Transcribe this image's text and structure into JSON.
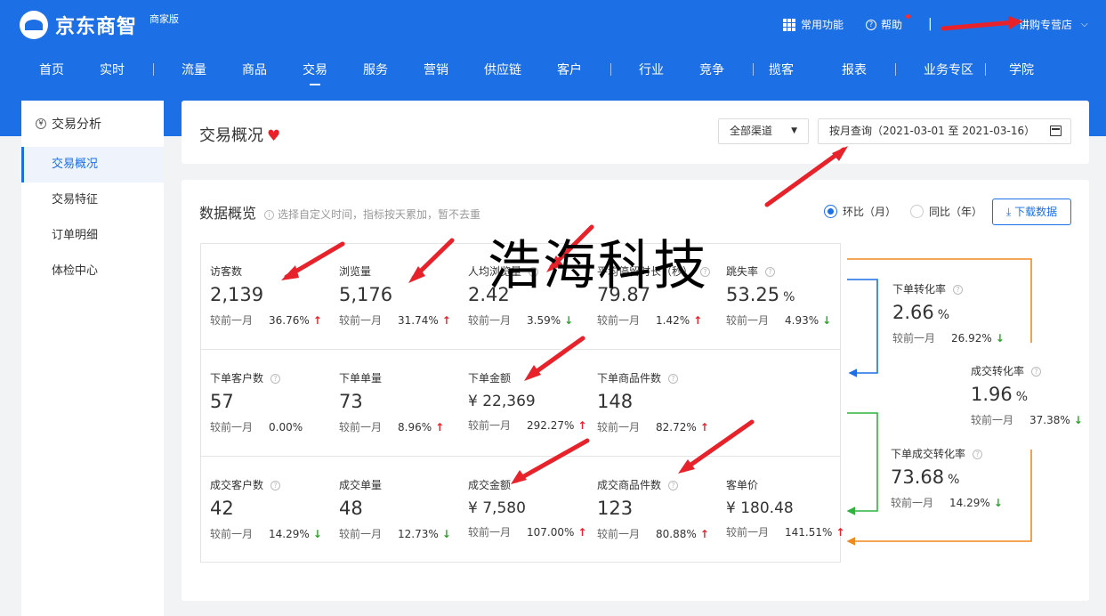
{
  "header": {
    "brand": "京东商智",
    "edition": "商家版",
    "tools": {
      "common": "常用功能",
      "help": "帮助",
      "shop": "讲购专营店"
    },
    "nav": [
      "首页",
      "实时",
      "流量",
      "商品",
      "交易",
      "服务",
      "营销",
      "供应链",
      "客户",
      "行业",
      "竞争",
      "揽客",
      "报表",
      "业务专区",
      "学院"
    ],
    "active_nav": "交易"
  },
  "sidebar": {
    "title": "交易分析",
    "items": [
      "交易概况",
      "交易特征",
      "订单明细",
      "体检中心"
    ],
    "active": "交易概况"
  },
  "overview": {
    "title": "交易概况",
    "channel": "全部渠道",
    "date_range": "按月查询（2021-03-01 至 2021-03-16）"
  },
  "data_panel": {
    "title": "数据概览",
    "hint": "选择自定义时间，指标按天累加，暂不去重",
    "radio_mom": "环比（月）",
    "radio_yoy": "同比（年）",
    "download": "下载数据",
    "compare_label": "较前一月"
  },
  "metrics": {
    "visitors": {
      "label": "访客数",
      "value": "2,139",
      "pct": "36.76%",
      "trend": "up"
    },
    "pageviews": {
      "label": "浏览量",
      "value": "5,176",
      "pct": "31.74%",
      "trend": "up"
    },
    "avg_pv": {
      "label": "人均浏览量",
      "value": "2.42",
      "pct": "3.59%",
      "trend": "down"
    },
    "avg_stay": {
      "label": "平均停留时长（秒）",
      "value": "79.87",
      "pct": "1.42%",
      "trend": "up"
    },
    "bounce": {
      "label": "跳失率",
      "value": "53.25",
      "unit": "%",
      "pct": "4.93%",
      "trend": "down"
    },
    "order_customers": {
      "label": "下单客户数",
      "value": "57",
      "pct": "0.00%",
      "trend": ""
    },
    "order_count": {
      "label": "下单单量",
      "value": "73",
      "pct": "8.96%",
      "trend": "up"
    },
    "order_amount": {
      "label": "下单金额",
      "value": "¥ 22,369",
      "pct": "292.27%",
      "trend": "up"
    },
    "order_items": {
      "label": "下单商品件数",
      "value": "148",
      "pct": "82.72%",
      "trend": "up"
    },
    "deal_customers": {
      "label": "成交客户数",
      "value": "42",
      "pct": "14.29%",
      "trend": "down"
    },
    "deal_count": {
      "label": "成交单量",
      "value": "48",
      "pct": "12.73%",
      "trend": "down"
    },
    "deal_amount": {
      "label": "成交金额",
      "value": "¥ 7,580",
      "pct": "107.00%",
      "trend": "up"
    },
    "deal_items": {
      "label": "成交商品件数",
      "value": "123",
      "pct": "80.88%",
      "trend": "up"
    },
    "avg_price": {
      "label": "客单价",
      "value": "¥ 180.48",
      "pct": "141.51%",
      "trend": "up"
    },
    "order_conv": {
      "label": "下单转化率",
      "value": "2.66",
      "unit": "%",
      "pct": "26.92%",
      "trend": "down"
    },
    "deal_conv": {
      "label": "成交转化率",
      "value": "1.96",
      "unit": "%",
      "pct": "37.38%",
      "trend": "down"
    },
    "order_deal_conv": {
      "label": "下单成交转化率",
      "value": "73.68",
      "unit": "%",
      "pct": "14.29%",
      "trend": "down"
    }
  },
  "watermark": "浩海科技",
  "colors": {
    "primary": "#1d6fe6",
    "up": "#e8222a",
    "down": "#2aa52a",
    "annotation": "#e8222a",
    "flow_blue": "#1d6fe6",
    "flow_orange": "#ef8a1e",
    "flow_green": "#2fb33d"
  }
}
